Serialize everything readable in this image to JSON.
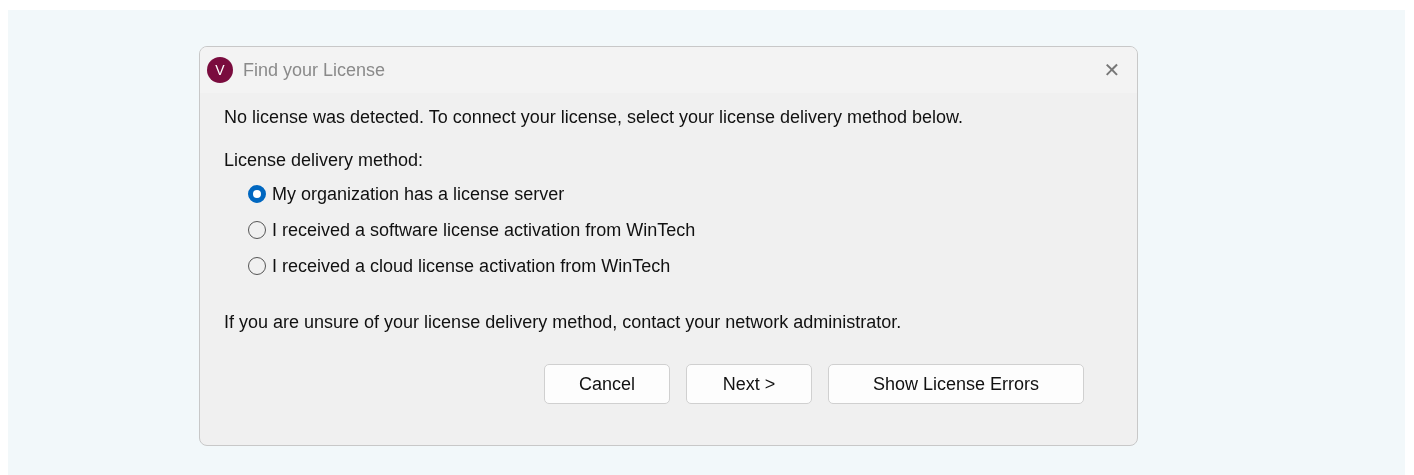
{
  "window": {
    "title": "Find your License",
    "app_icon_letter": "V",
    "close": "✕"
  },
  "intro": "No license was detected. To connect your license, select your license delivery method below.",
  "group_label": "License delivery method:",
  "options": [
    {
      "label": "My organization has a license server",
      "selected": true
    },
    {
      "label": "I received a software license activation from WinTech",
      "selected": false
    },
    {
      "label": "I received a cloud license activation from WinTech",
      "selected": false
    }
  ],
  "note": "If you are unsure of your license delivery method, contact your network administrator.",
  "buttons": [
    "Cancel",
    "Next >",
    "Show License Errors"
  ]
}
